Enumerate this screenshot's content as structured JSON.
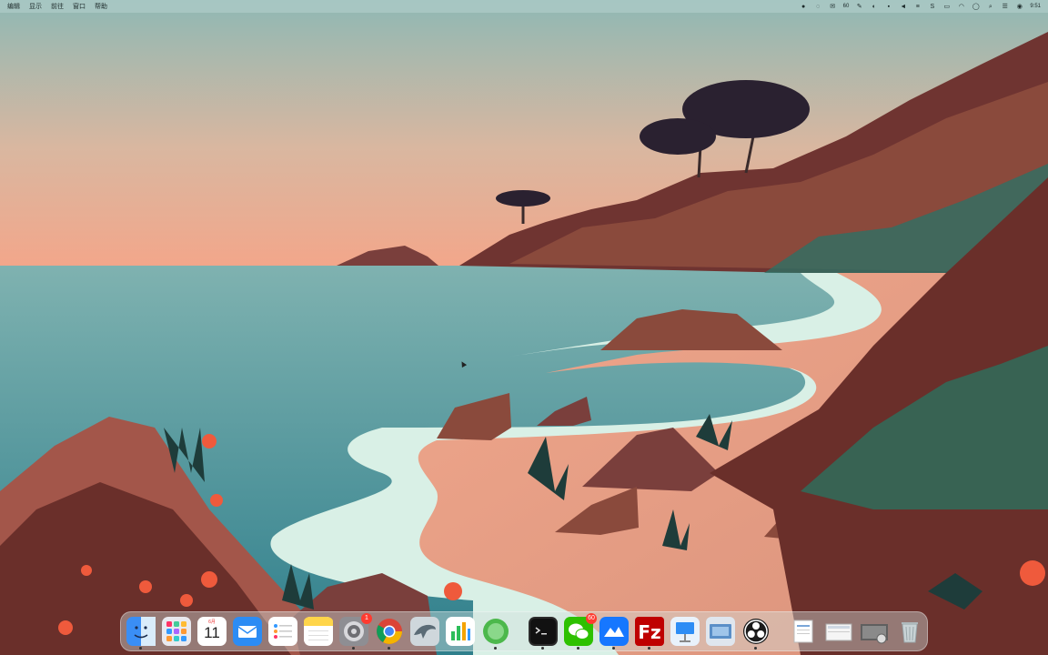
{
  "menubar": {
    "menus": [
      "编辑",
      "显示",
      "前往",
      "窗口",
      "帮助"
    ],
    "status_icons": [
      {
        "icon": "app-icon",
        "glyph": "●"
      },
      {
        "icon": "record-icon",
        "glyph": "◌"
      },
      {
        "icon": "wechat-icon",
        "glyph": "✉"
      },
      {
        "icon": "count-text",
        "glyph": "60"
      },
      {
        "icon": "pen-icon",
        "glyph": "✎"
      },
      {
        "icon": "headphones-icon",
        "glyph": "◐"
      },
      {
        "icon": "message-icon",
        "glyph": "▪"
      },
      {
        "icon": "volume-icon",
        "glyph": "◄"
      },
      {
        "icon": "network-icon",
        "glyph": "≡"
      },
      {
        "icon": "keyboard-icon",
        "glyph": "S"
      },
      {
        "icon": "battery-icon",
        "glyph": "▭"
      },
      {
        "icon": "wifi-icon",
        "glyph": "◠"
      },
      {
        "icon": "user-icon",
        "glyph": "◯"
      },
      {
        "icon": "search-icon",
        "glyph": "⌕"
      },
      {
        "icon": "control-center-icon",
        "glyph": "☰"
      },
      {
        "icon": "siri-icon",
        "glyph": "◉"
      },
      {
        "icon": "clock-text",
        "glyph": "9:51"
      }
    ]
  },
  "dock": {
    "calendar": {
      "month": "6月",
      "day": "11"
    },
    "badges": {
      "system_prefs": "1",
      "wechat": "60"
    },
    "apps": [
      {
        "name": "finder",
        "label": "Finder"
      },
      {
        "name": "launchpad",
        "label": "Launchpad"
      },
      {
        "name": "calendar",
        "label": "Calendar"
      },
      {
        "name": "mail",
        "label": "Mail"
      },
      {
        "name": "reminders",
        "label": "Reminders"
      },
      {
        "name": "notes",
        "label": "Notes"
      },
      {
        "name": "system-preferences",
        "label": "System Preferences"
      },
      {
        "name": "chrome",
        "label": "Chrome"
      },
      {
        "name": "dolphin",
        "label": "Dolphin"
      },
      {
        "name": "numbers",
        "label": "Numbers"
      },
      {
        "name": "green-app",
        "label": "App"
      },
      {
        "name": "terminal",
        "label": "Terminal"
      },
      {
        "name": "wechat",
        "label": "WeChat"
      },
      {
        "name": "lark",
        "label": "Lark"
      },
      {
        "name": "filezilla",
        "label": "FileZilla"
      },
      {
        "name": "keynote",
        "label": "Keynote"
      },
      {
        "name": "preview",
        "label": "Preview"
      },
      {
        "name": "obs",
        "label": "OBS"
      },
      {
        "name": "document-stack",
        "label": "Documents"
      },
      {
        "name": "screenshot-stack",
        "label": "Screenshots"
      },
      {
        "name": "downloads-stack",
        "label": "Downloads"
      },
      {
        "name": "trash",
        "label": "Trash"
      }
    ]
  },
  "colors": {
    "sky_top": "#8fb8b4",
    "sky_bottom": "#f0a98c",
    "sea": "#4b8e93",
    "sand": "#e79f86",
    "rock": "#8a4a3c",
    "cliff": "#6a2f2a"
  }
}
